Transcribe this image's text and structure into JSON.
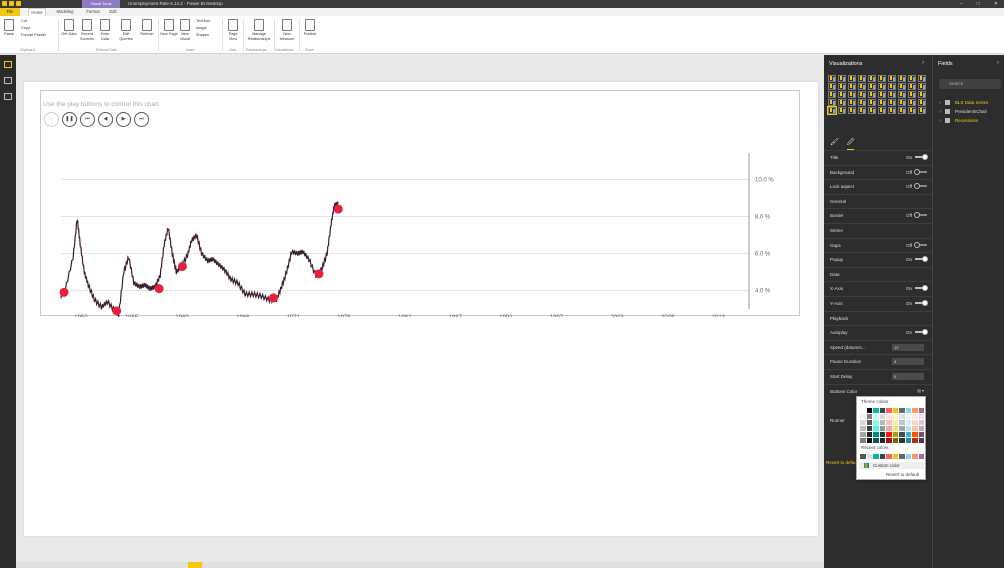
{
  "window": {
    "title": "Unemployment Rate 6.14.2 - Power BI Desktop",
    "context_tab": "Visual Tools",
    "controls": [
      "–",
      "□",
      "✕"
    ]
  },
  "menu_tabs": [
    "File",
    "Home",
    "Modeling",
    "Format",
    "Edit"
  ],
  "ribbon": {
    "clipboard": {
      "paste": "Paste",
      "cut": "Cut",
      "copy": "Copy",
      "format_painter": "Format Painter",
      "group": "Clipboard"
    },
    "external_data": {
      "get_data": "Get Data",
      "recent_sources": "Recent Sources",
      "enter_data": "Enter Data",
      "edit_queries": "Edit Queries",
      "refresh": "Refresh",
      "group": "External Data"
    },
    "insert": {
      "new_page": "New Page",
      "new_visual": "New Visual",
      "text_box": "Text box",
      "image": "Image",
      "shapes": "Shapes",
      "group": "Insert"
    },
    "view": {
      "page_view": "Page View",
      "group": "View"
    },
    "relationships": {
      "manage": "Manage Relationships",
      "group": "Relationships"
    },
    "calculations": {
      "new_measure": "New Measure",
      "group": "Calculations"
    },
    "share": {
      "publish": "Publish",
      "group": "Share"
    }
  },
  "visual": {
    "prompt_text": "Use the play buttons to control this chart",
    "controls": [
      "▷",
      "❚❚",
      "⏮",
      "◀",
      "▶",
      "⏭"
    ]
  },
  "chart_data": {
    "type": "line",
    "x_ticks": [
      "1950",
      "1955",
      "1960",
      "1966",
      "1971",
      "1976",
      "1982",
      "1987",
      "1992",
      "1997",
      "2003",
      "2008",
      "2013"
    ],
    "y_ticks": [
      "4.0 %",
      "6.0 %",
      "8.0 %",
      "10.0 %"
    ],
    "ylim": [
      3,
      11
    ],
    "xlim": [
      1948,
      2016
    ],
    "series": [
      {
        "values": [
          [
            1948,
            3.7
          ],
          [
            1948.4,
            4.0
          ],
          [
            1949.2,
            5.8
          ],
          [
            1949.6,
            7.9
          ],
          [
            1949.9,
            6.5
          ],
          [
            1950.3,
            5.0
          ],
          [
            1950.7,
            4.3
          ],
          [
            1951.3,
            3.5
          ],
          [
            1952.0,
            3.1
          ],
          [
            1952.6,
            3.4
          ],
          [
            1953.3,
            2.9
          ],
          [
            1953.7,
            2.7
          ],
          [
            1954.2,
            5.0
          ],
          [
            1954.7,
            5.8
          ],
          [
            1955.2,
            4.4
          ],
          [
            1955.8,
            4.2
          ],
          [
            1956.3,
            4.3
          ],
          [
            1956.8,
            4.1
          ],
          [
            1957.3,
            4.2
          ],
          [
            1957.8,
            4.8
          ],
          [
            1958.2,
            6.5
          ],
          [
            1958.6,
            7.4
          ],
          [
            1959.0,
            6.0
          ],
          [
            1959.4,
            5.0
          ],
          [
            1959.9,
            5.3
          ],
          [
            1960.5,
            5.9
          ],
          [
            1960.9,
            6.7
          ],
          [
            1961.4,
            7.0
          ],
          [
            1961.9,
            6.0
          ],
          [
            1962.5,
            5.6
          ],
          [
            1963.0,
            5.7
          ],
          [
            1963.6,
            5.4
          ],
          [
            1964.2,
            5.1
          ],
          [
            1964.8,
            4.6
          ],
          [
            1965.5,
            4.4
          ],
          [
            1966.2,
            3.8
          ],
          [
            1967.0,
            3.8
          ],
          [
            1967.8,
            3.7
          ],
          [
            1968.6,
            3.5
          ],
          [
            1969.3,
            3.5
          ],
          [
            1969.8,
            4.2
          ],
          [
            1970.3,
            5.0
          ],
          [
            1970.8,
            6.1
          ],
          [
            1971.4,
            6.0
          ],
          [
            1971.9,
            6.1
          ],
          [
            1972.5,
            5.7
          ],
          [
            1973.2,
            4.8
          ],
          [
            1973.8,
            5.2
          ],
          [
            1974.3,
            6.0
          ],
          [
            1974.7,
            7.6
          ],
          [
            1975.0,
            8.6
          ],
          [
            1975.4,
            8.7
          ]
        ]
      }
    ],
    "markers": [
      [
        1948.3,
        3.9
      ],
      [
        1953.5,
        2.9
      ],
      [
        1957.7,
        4.1
      ],
      [
        1960.0,
        5.3
      ],
      [
        1969.0,
        3.6
      ],
      [
        1973.5,
        4.9
      ],
      [
        1975.4,
        8.4
      ]
    ]
  },
  "visualizations_pane": {
    "title": "Visualizations",
    "chevron": "›",
    "tool_icons": [
      "🖌",
      "🖉"
    ],
    "sections": [
      {
        "label": "Title",
        "state": "On",
        "toggle": "on"
      },
      {
        "label": "Background",
        "state": "Off",
        "toggle": "off"
      },
      {
        "label": "Lock aspect",
        "state": "Off",
        "toggle": "off"
      },
      {
        "label": "General"
      },
      {
        "label": "Border",
        "state": "Off",
        "toggle": "off"
      },
      {
        "label": "Series"
      },
      {
        "label": "Gaps",
        "state": "Off",
        "toggle": "off"
      },
      {
        "label": "Popup",
        "state": "On",
        "toggle": "on"
      },
      {
        "label": "Data"
      },
      {
        "label": "X-Axis",
        "state": "On",
        "toggle": "on"
      },
      {
        "label": "Y-Axis",
        "state": "On",
        "toggle": "on"
      },
      {
        "label": "Playback"
      },
      {
        "label": "Autoplay",
        "state": "On",
        "toggle": "on"
      },
      {
        "label": "Speed (datum/s...",
        "value": "12"
      },
      {
        "label": "Pause Duration",
        "value": "4"
      },
      {
        "label": "Start Delay",
        "value": "0"
      },
      {
        "label": "Buttons Color",
        "swatch": "▤ ▾"
      }
    ],
    "revert": "Revert to default",
    "runner": "Runner"
  },
  "color_picker": {
    "theme_label": "Theme colors",
    "recent_label": "Recent colors",
    "custom_label": "Custom color",
    "revert_label": "Revert to default",
    "theme_colors": [
      "#ffffff",
      "#000000",
      "#01b8aa",
      "#374649",
      "#fd625e",
      "#f2c80f",
      "#5f6b6d",
      "#8ad4eb",
      "#fe9666",
      "#a66999",
      "#f2f2f2",
      "#7f7f7f",
      "#c3fcf7",
      "#d7dddf",
      "#fee0df",
      "#fcf4cf",
      "#dfe1e2",
      "#e8f6fb",
      "#ffeae0",
      "#eddfea",
      "#d9d9d9",
      "#595959",
      "#88f9ee",
      "#afbbbf",
      "#fec0be",
      "#fae99f",
      "#bfc4c5",
      "#d0edf7",
      "#ffd5c2",
      "#dbc3d6",
      "#bfbfbf",
      "#3f3f3f",
      "#4cf6e7",
      "#879ba0",
      "#fda19e",
      "#f7de6f",
      "#9fa6a7",
      "#b9e5f3",
      "#fec0a3",
      "#c9a5c2",
      "#a5a5a5",
      "#262626",
      "#018a80",
      "#293437",
      "#fc110c",
      "#b6960b",
      "#474f51",
      "#37b6dc",
      "#fd5203",
      "#7d4e72",
      "#7f7f7f",
      "#0c0c0c",
      "#005c55",
      "#1b2324",
      "#a80703",
      "#796407",
      "#2f3536",
      "#1c89ab",
      "#a93601",
      "#533448"
    ],
    "recent_colors": [
      "#555555",
      "#e0e0e0",
      "#01b8aa",
      "#374649",
      "#fd625e",
      "#f2c80f",
      "#5f6b6d",
      "#8ad4eb",
      "#fe9666",
      "#a66999"
    ]
  },
  "fields_pane": {
    "title": "Fields",
    "chevron": "›",
    "search_placeholder": "Search",
    "items": [
      {
        "label": "BLS Data Series",
        "color": "yellow"
      },
      {
        "label": "PresidentsChair",
        "color": "white"
      },
      {
        "label": "Recessions",
        "color": "yellow"
      }
    ]
  }
}
